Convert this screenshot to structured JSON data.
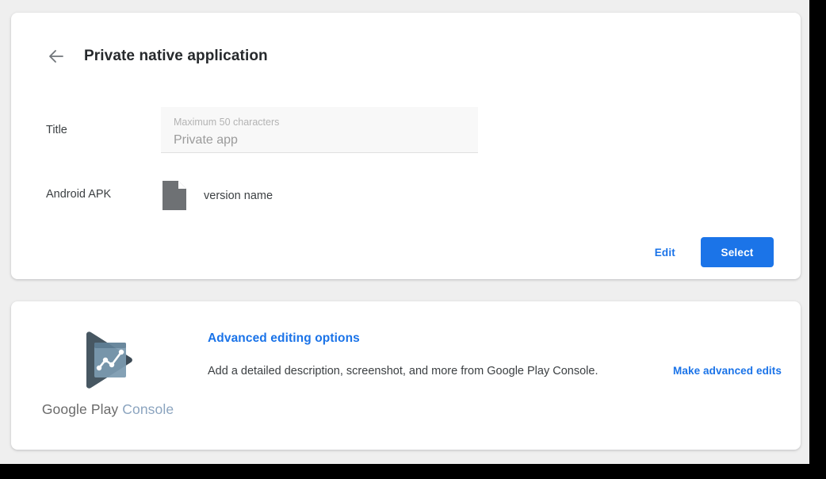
{
  "header": {
    "back_icon": "back-arrow-icon",
    "title": "Private native application"
  },
  "form": {
    "title_field": {
      "label": "Title",
      "hint": "Maximum 50 characters",
      "value": "Private app"
    },
    "apk_field": {
      "label": "Android APK",
      "file_icon": "file-document-icon",
      "version": "version name"
    }
  },
  "actions": {
    "edit_label": "Edit",
    "select_label": "Select"
  },
  "advanced": {
    "logo_icon": "google-play-console-logo-icon",
    "wordmark_google": "Google",
    "wordmark_play": "Play",
    "wordmark_console": "Console",
    "heading": "Advanced editing options",
    "description": "Add a detailed description, screenshot, and more from Google Play Console.",
    "link_label": "Make advanced edits"
  },
  "colors": {
    "accent_blue": "#1a73e8",
    "button_blue": "#1b74e8",
    "page_background": "#efefef",
    "card_background": "#ffffff",
    "text_primary": "#3c4043",
    "text_muted": "#9b9b9b",
    "hint_gray": "#b3b3b3",
    "file_icon_gray": "#6e7174",
    "logo_dark": "#3c4a55",
    "logo_panel": "#7b9ab0",
    "wordmark_console": "#8ba4bf"
  }
}
